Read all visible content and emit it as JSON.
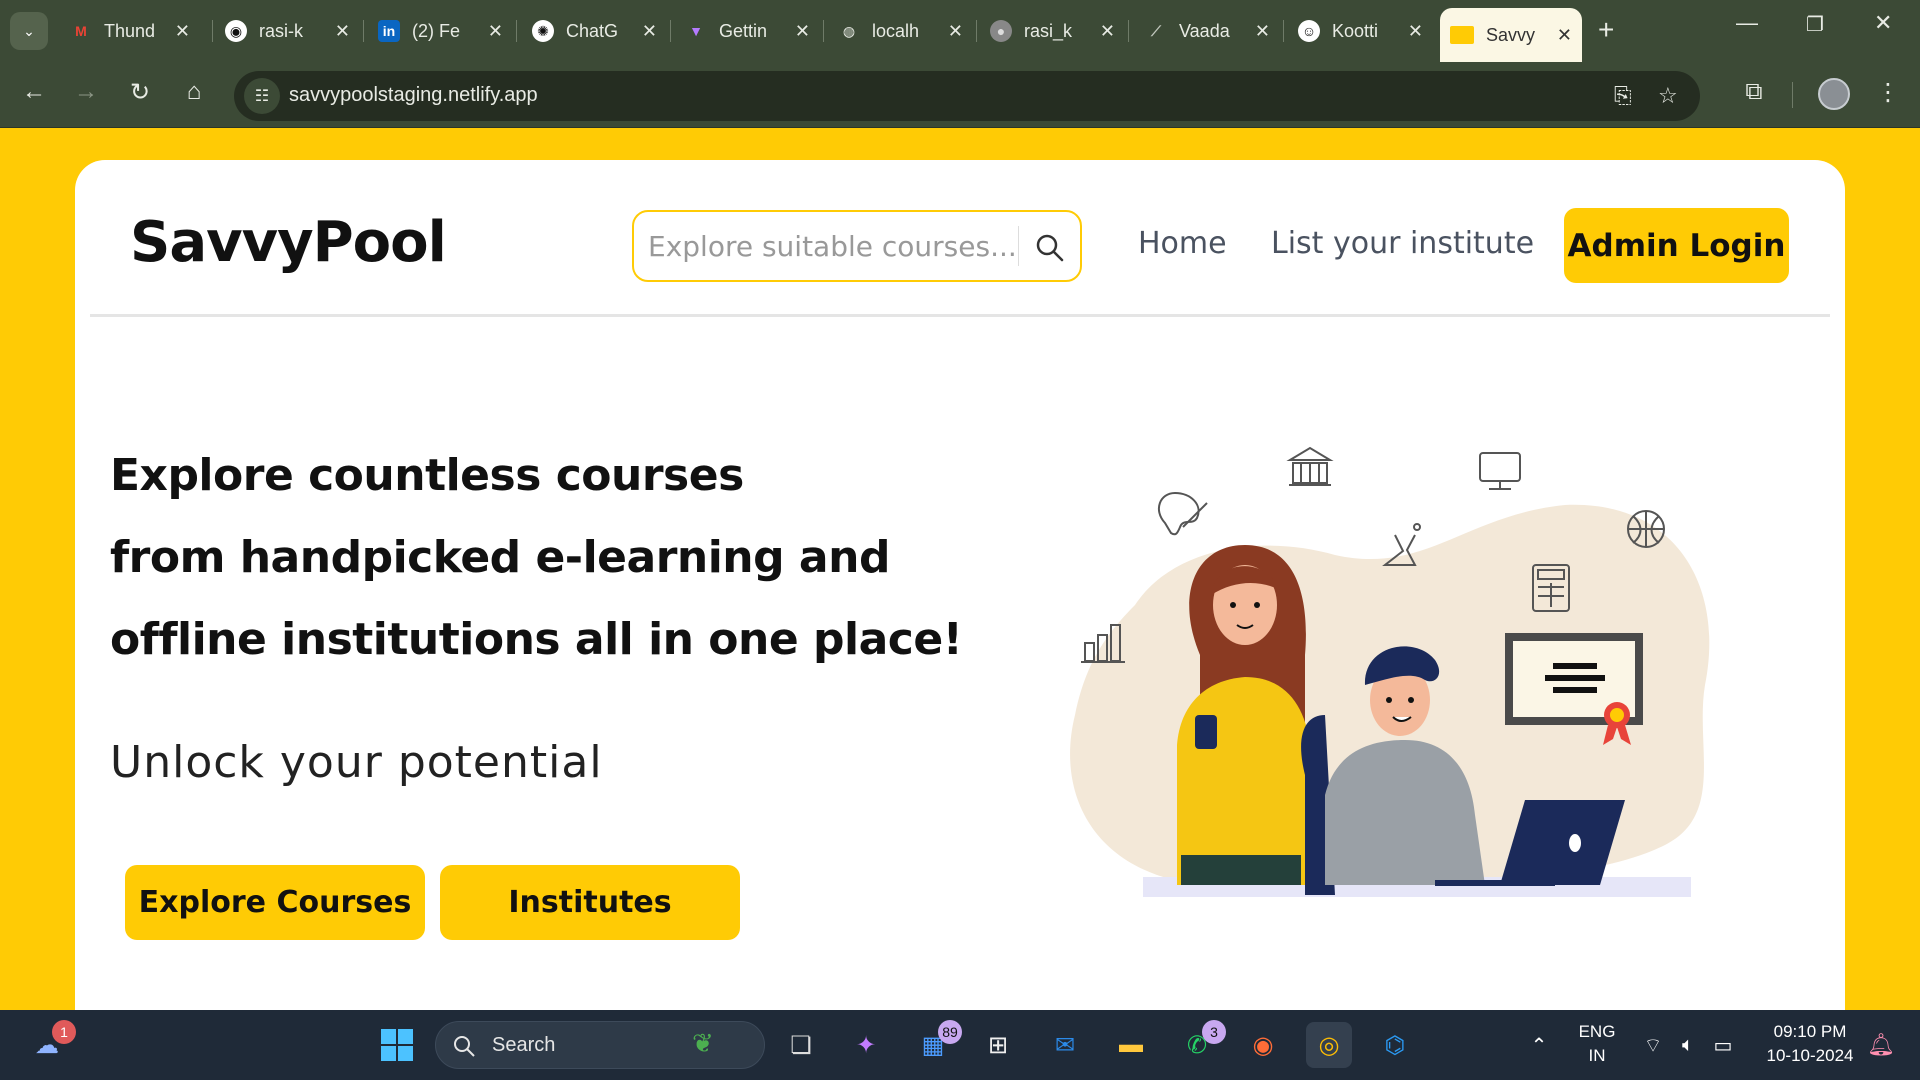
{
  "browser": {
    "tabs": [
      {
        "label": "Thund",
        "icon": "gmail-icon"
      },
      {
        "label": "rasi-k",
        "icon": "github-icon"
      },
      {
        "label": "(2) Fe",
        "icon": "linkedin-icon"
      },
      {
        "label": "ChatG",
        "icon": "chatgpt-icon"
      },
      {
        "label": "Gettin",
        "icon": "vite-icon"
      },
      {
        "label": "localh",
        "icon": "globe-icon"
      },
      {
        "label": "rasi_k",
        "icon": "avatar-icon"
      },
      {
        "label": "Vaada",
        "icon": "vaadin-icon"
      },
      {
        "label": "Kootti",
        "icon": "kootti-icon"
      },
      {
        "label": "Savvy",
        "icon": "savvypool-icon"
      }
    ],
    "active_tab_index": 9,
    "url": "savvypoolstaging.netlify.app"
  },
  "site": {
    "logo": "SavvyPool",
    "search_placeholder": "Explore suitable courses...",
    "nav": {
      "home": "Home",
      "list_institute": "List your institute",
      "admin_login": "Admin Login"
    },
    "hero": {
      "line1": "Explore countless courses",
      "line2": "from handpicked e-learning and",
      "line3": "offline institutions all in one place!",
      "tagline": "Unlock your potential",
      "cta_courses": "Explore Courses",
      "cta_institutes": "Institutes"
    }
  },
  "taskbar": {
    "search_label": "Search",
    "weather_badge": "1",
    "outlook_badge": "89",
    "whatsapp_badge": "3",
    "language": "ENG",
    "region": "IN",
    "time": "09:10 PM",
    "date": "10-10-2024"
  },
  "colors": {
    "brand_yellow": "#ffcb05",
    "chrome_bg": "#3c4a36",
    "taskbar_bg": "#1f2a38"
  }
}
